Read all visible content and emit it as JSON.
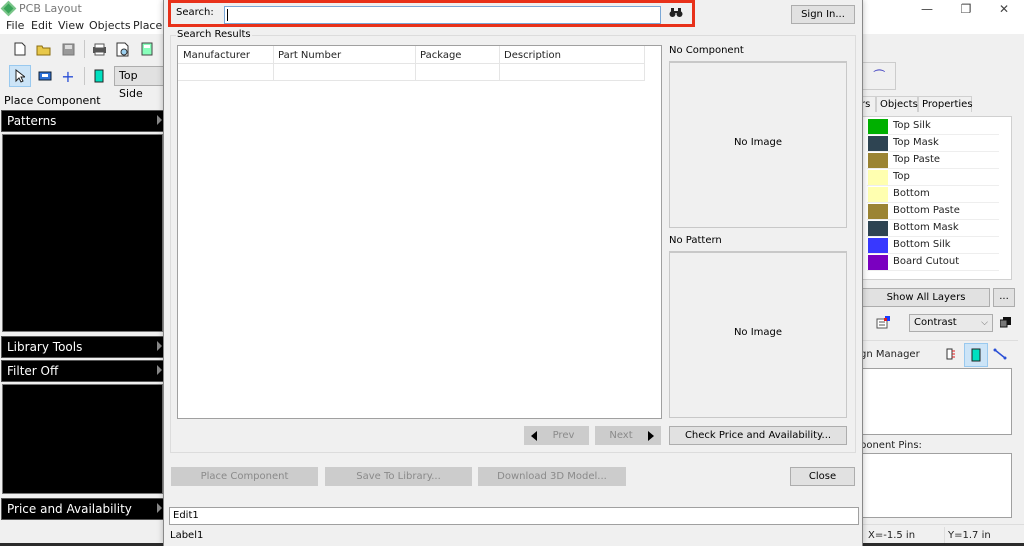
{
  "app": {
    "title": "PCB Layout",
    "window_controls": {
      "minimize": "—",
      "restore": "❐",
      "close": "✕"
    },
    "menu": [
      "File",
      "Edit",
      "View",
      "Objects",
      "Placem"
    ]
  },
  "toolbar": {
    "side_select": "Top Side",
    "icons": [
      "new-file-icon",
      "open-folder-icon",
      "save-icon",
      "print-icon",
      "print-preview-icon",
      "calculator-icon",
      "pointer-icon",
      "measure-icon",
      "crosshair-icon",
      "component-icon"
    ]
  },
  "left_panel": {
    "place_component": "Place Component",
    "patterns": "Patterns",
    "library_tools": "Library Tools",
    "filter": "Filter Off",
    "price_availability": "Price and Availability"
  },
  "right_panel": {
    "tabs": [
      "rs",
      "Objects",
      "Properties"
    ],
    "layers": [
      {
        "name": "Top Silk",
        "color": "#00b000"
      },
      {
        "name": "Top Mask",
        "color": "#2e4452"
      },
      {
        "name": "Top Paste",
        "color": "#9b8433"
      },
      {
        "name": "Top",
        "color": "#ffffb0"
      },
      {
        "name": "Bottom",
        "color": "#ffffb0"
      },
      {
        "name": "Bottom Paste",
        "color": "#9b8433"
      },
      {
        "name": "Bottom Mask",
        "color": "#2e4452"
      },
      {
        "name": "Bottom Silk",
        "color": "#3838ff"
      },
      {
        "name": "Board Cutout",
        "color": "#7a00c0"
      }
    ],
    "show_all_layers": "Show All Layers",
    "more": "...",
    "contrast_mode": "Contrast",
    "design_manager_label": "gn Manager",
    "component_pins_label": "ponent Pins:",
    "status": {
      "x": "X=-1.5 in",
      "y": "Y=1.7 in"
    }
  },
  "dialog": {
    "search": {
      "label": "Search:",
      "value": "",
      "placeholder": ""
    },
    "sign_in": "Sign In...",
    "results": {
      "title": "Search Results",
      "columns": [
        "Manufacturer",
        "Part Number",
        "Package",
        "Description"
      ],
      "rows": []
    },
    "component_preview": {
      "title": "No Component",
      "text": "No Image"
    },
    "pattern_preview": {
      "title": "No Pattern",
      "text": "No Image"
    },
    "prev": "Prev",
    "next": "Next",
    "check_price": "Check Price and Availability...",
    "place_component": "Place Component",
    "save_to_library": "Save To Library...",
    "download_3d": "Download 3D Model...",
    "close": "Close",
    "edit1": "Edit1",
    "label1": "Label1"
  },
  "colors": {
    "highlight": "#e8311a",
    "input_focus": "#7aa7d6"
  }
}
